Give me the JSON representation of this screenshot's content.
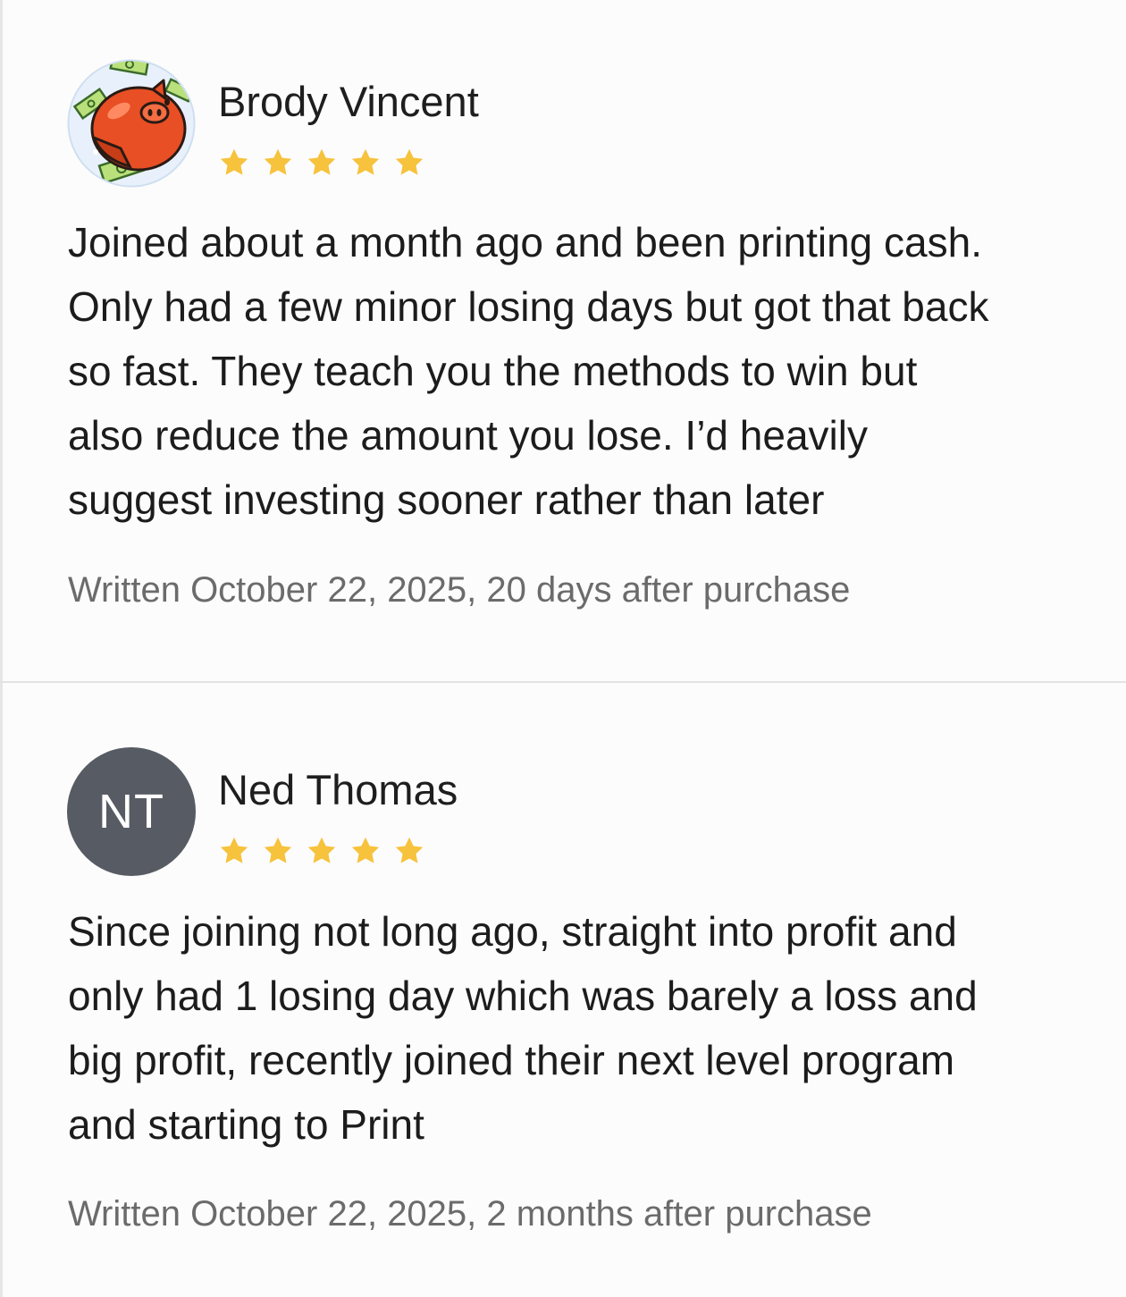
{
  "colors": {
    "star": "#f7c23c",
    "avatar_initials_bg": "#575b63",
    "meta_text": "#6b6b6b",
    "divider": "#e3e3e3"
  },
  "reviews": [
    {
      "reviewer_name": "Brody Vincent",
      "avatar": {
        "type": "image",
        "icon": "piggy-bank-money-icon"
      },
      "rating": 5,
      "text_lines": [
        "Joined about a month ago and been printing cash.",
        "Only had a few minor losing days but got that back",
        "so fast. They teach you the methods to win but",
        "also reduce the amount you lose. I’d heavily",
        "suggest investing sooner rather than later"
      ],
      "meta": "Written October 22, 2025, 20 days after purchase"
    },
    {
      "reviewer_name": "Ned Thomas",
      "avatar": {
        "type": "initials",
        "initials": "NT"
      },
      "rating": 5,
      "text_lines": [
        "Since joining not long ago, straight into profit and",
        "only had 1 losing day which was barely a loss and",
        "big profit, recently joined their next level program",
        "and starting to Print"
      ],
      "meta": "Written October 22, 2025, 2 months after purchase"
    }
  ]
}
